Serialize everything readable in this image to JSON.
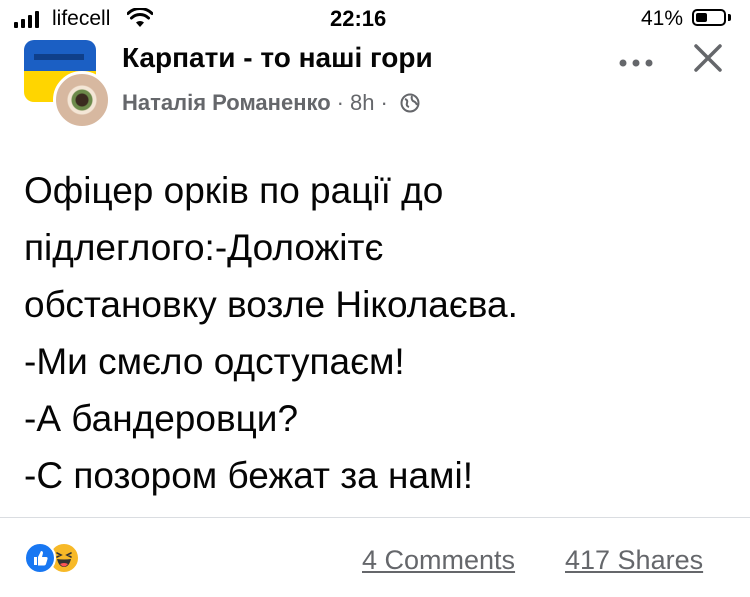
{
  "status_bar": {
    "carrier": "lifecell",
    "time": "22:16",
    "battery_percent": "41%",
    "battery_level": 0.41,
    "signal_bars": 4,
    "icons": [
      "signal-icon",
      "wifi-icon",
      "battery-icon"
    ]
  },
  "post": {
    "group_name": "Карпати - то наші гори",
    "author": "Наталія Романенко",
    "separator": "·",
    "time_ago": "8h",
    "privacy_icon": "globe-icon",
    "more_icon": "more-icon",
    "close_icon": "close-icon",
    "lines": [
      "Офіцер орків по рації до",
      "підлеглого:-Доложітє",
      "обстановку возле Ніколаєва.",
      "-Ми смєло одступаєм!",
      "-А бандеровци?",
      "-С позором бежат за намі!"
    ]
  },
  "footer": {
    "reactions": [
      "like-reaction-icon",
      "haha-reaction-icon"
    ],
    "comments": "4 Comments",
    "shares": "417 Shares"
  },
  "colors": {
    "text": "#050505",
    "secondary_text": "#65676b",
    "like_blue": "#1877f2",
    "haha_yellow": "#f7b928",
    "flag_blue": "#1b5fc4",
    "flag_yellow": "#ffd500"
  }
}
